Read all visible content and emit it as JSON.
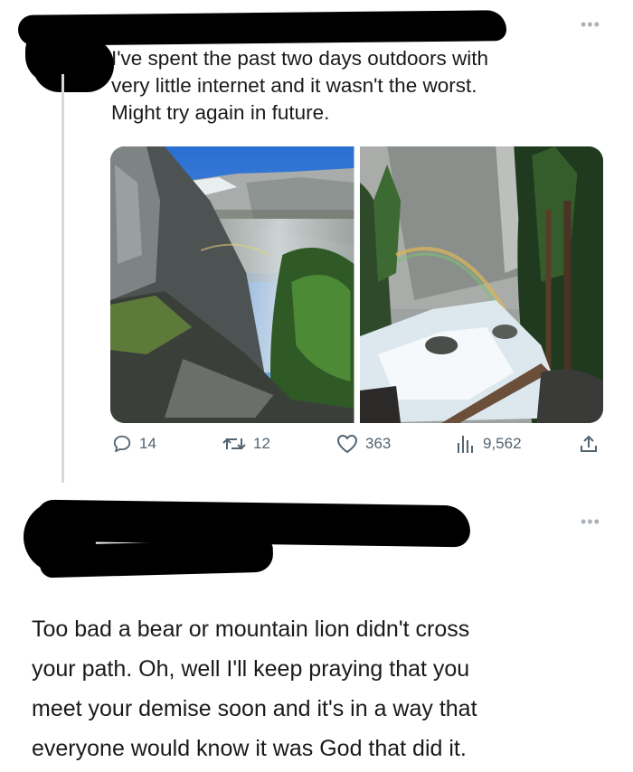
{
  "tweet": {
    "text_lines": [
      "I've spent the past two days outdoors with",
      "very little internet and it wasn't the worst.",
      "Might try again in future."
    ],
    "media": [
      {
        "description_icon": "photo-waterfall-cliff"
      },
      {
        "description_icon": "photo-river-rainbow"
      }
    ],
    "metrics": {
      "replies": "14",
      "retweets": "12",
      "likes": "363",
      "views": "9,562"
    }
  },
  "reply": {
    "text_lines": [
      "Too bad a bear or mountain lion didn't cross",
      "your path. Oh, well I'll keep praying that you",
      "meet your demise soon and it's in a way that",
      "everyone would know it was God that did it."
    ]
  },
  "colors": {
    "icon_gray": "#536471",
    "thread_line": "#d6d9db",
    "redaction": "#000000"
  }
}
